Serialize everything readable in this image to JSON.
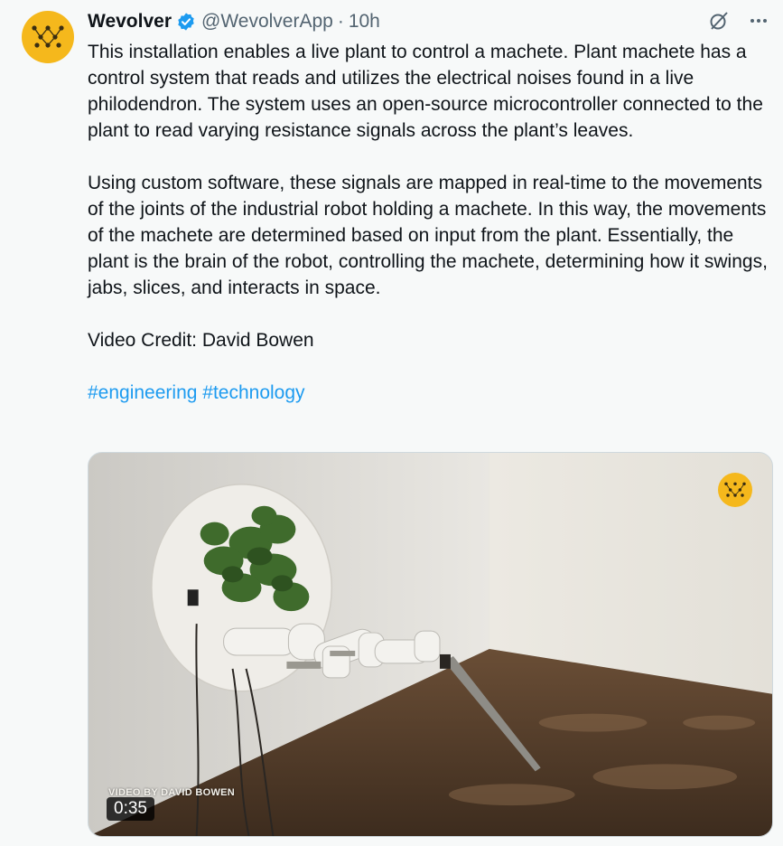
{
  "author": {
    "name": "Wevolver",
    "handle": "@WevolverApp",
    "separator": "·",
    "time": "10h",
    "avatar_icon": "wevolver-logo-icon",
    "verified_icon": "verified-badge-icon",
    "brand_color": "#f5b81c"
  },
  "actions": {
    "grok_icon": "grok-icon",
    "more_icon": "more-options-icon"
  },
  "tweet": {
    "paragraph1": "This installation enables a live plant to control a machete. Plant machete has a control system that reads and utilizes the electrical noises found in a live philodendron. The system uses an open-source microcontroller connected to the plant to read varying resistance signals across the plant’s leaves.",
    "paragraph2": "Using custom software, these signals are mapped in real-time to the movements of the joints of the industrial robot holding a machete. In this way, the movements of the machete are determined based on input from the plant. Essentially, the plant is the brain of the robot, controlling the machete, determining how it swings, jabs, slices, and interacts in space.",
    "paragraph3": "Video Credit: David Bowen",
    "hashtags": [
      "#engineering",
      "#technology"
    ],
    "link_color": "#1d9bf0"
  },
  "media": {
    "watermark": "VIDEO BY DAVID BOWEN",
    "duration": "0:35",
    "overlay_icon": "wevolver-logo-icon"
  }
}
